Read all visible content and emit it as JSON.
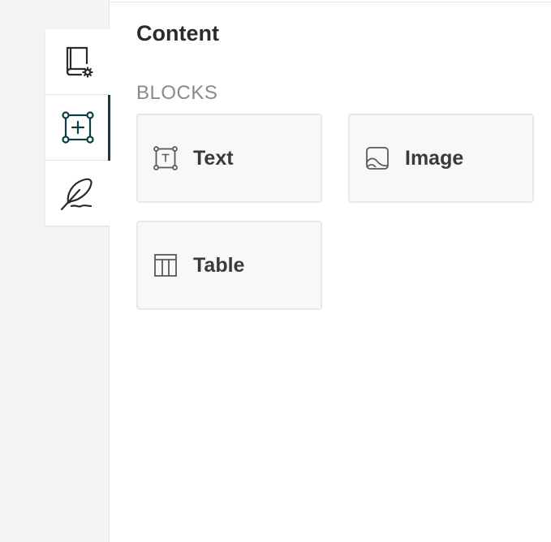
{
  "sidebar": {
    "tabs": [
      {
        "name": "settings",
        "icon": "book-settings-icon",
        "active": false
      },
      {
        "name": "blocks",
        "icon": "add-block-icon",
        "active": true
      },
      {
        "name": "design",
        "icon": "feather-pen-icon",
        "active": false
      }
    ]
  },
  "panel": {
    "title": "Content",
    "section_label": "BLOCKS",
    "blocks": [
      {
        "label": "Text",
        "icon": "text-box-icon"
      },
      {
        "label": "Image",
        "icon": "image-icon"
      },
      {
        "label": "Table",
        "icon": "table-icon"
      }
    ]
  },
  "colors": {
    "accent": "#0e3d45",
    "rail_background": "#f3f4f3",
    "block_background": "#f7f8f8",
    "block_border": "#e7e8e8"
  }
}
